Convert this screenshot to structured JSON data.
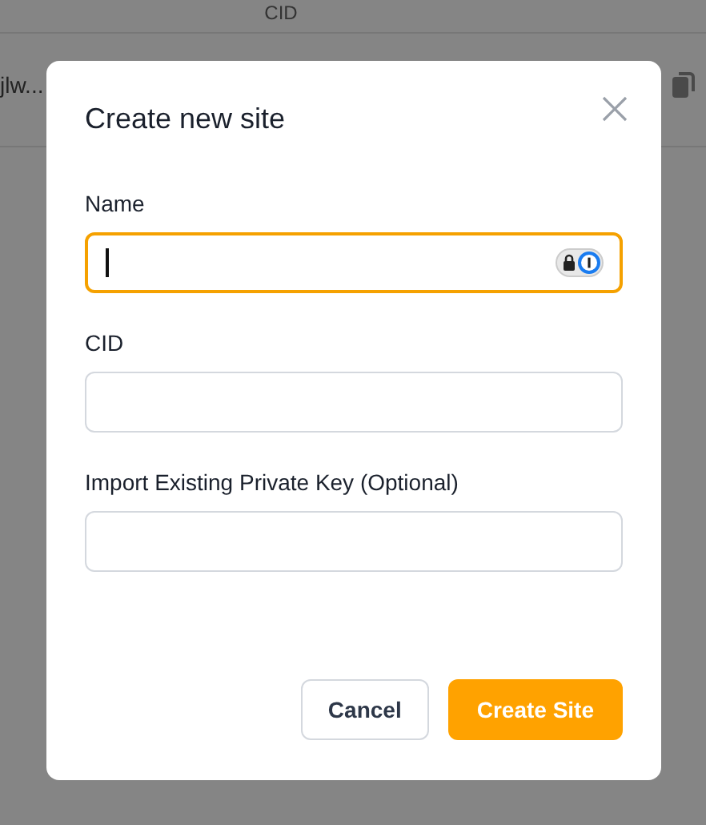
{
  "background": {
    "column_header": "CID",
    "row_text": "jlw..."
  },
  "dialog": {
    "title": "Create new site",
    "fields": [
      {
        "label": "Name",
        "focused": true,
        "password_manager": true
      },
      {
        "label": "CID",
        "focused": false,
        "password_manager": false
      },
      {
        "label": "Import Existing Private Key (Optional)",
        "focused": false,
        "password_manager": false
      }
    ],
    "buttons": [
      {
        "label": "Cancel",
        "kind": "secondary"
      },
      {
        "label": "Create Site",
        "kind": "primary"
      }
    ]
  }
}
